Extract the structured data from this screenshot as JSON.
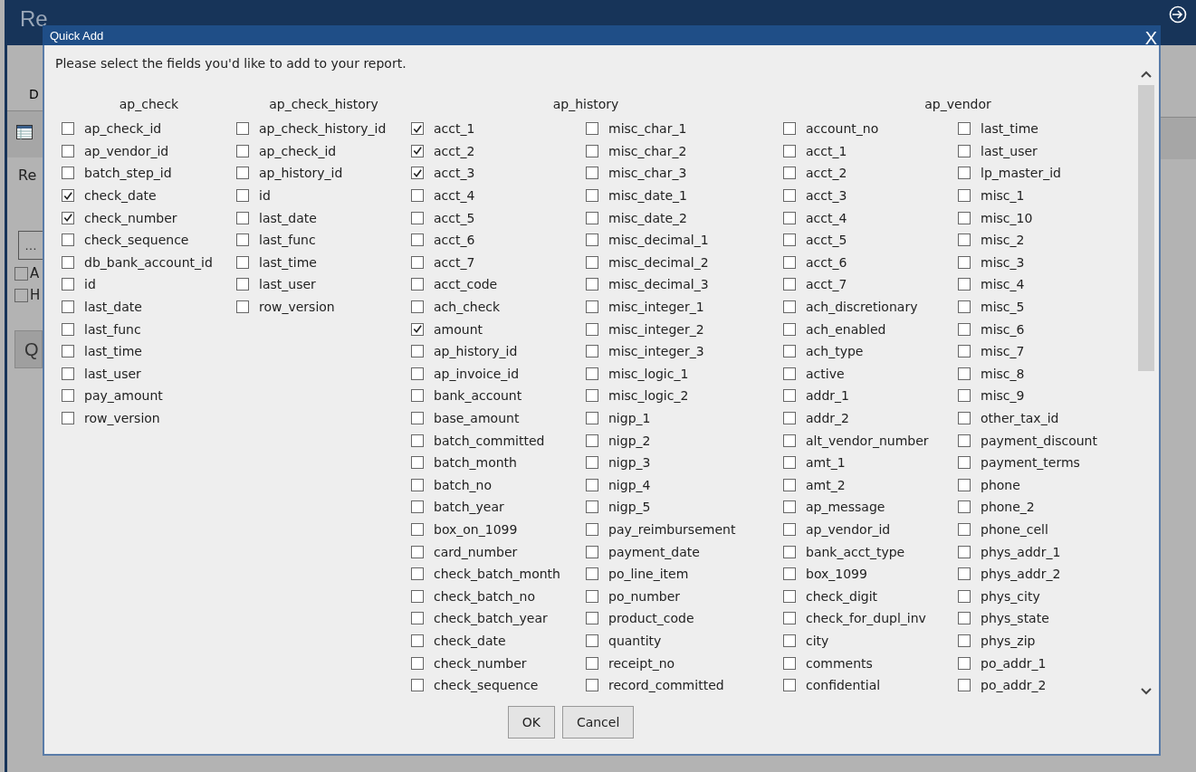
{
  "app": {
    "title": "Re",
    "tab": "D",
    "label": "Re",
    "browse_button": "…",
    "options": [
      {
        "label": "A",
        "checked": false
      },
      {
        "label": "H",
        "checked": false
      }
    ],
    "action_button": "Q"
  },
  "dialog": {
    "title": "Quick Add",
    "close": "X",
    "instruction": "Please select the fields you'd like to add to your report.",
    "groups": [
      {
        "name": "ap_check",
        "columns": [
          [
            {
              "label": "ap_check_id",
              "checked": false
            },
            {
              "label": "ap_vendor_id",
              "checked": false
            },
            {
              "label": "batch_step_id",
              "checked": false
            },
            {
              "label": "check_date",
              "checked": true
            },
            {
              "label": "check_number",
              "checked": true
            },
            {
              "label": "check_sequence",
              "checked": false
            },
            {
              "label": "db_bank_account_id",
              "checked": false
            },
            {
              "label": "id",
              "checked": false
            },
            {
              "label": "last_date",
              "checked": false
            },
            {
              "label": "last_func",
              "checked": false
            },
            {
              "label": "last_time",
              "checked": false
            },
            {
              "label": "last_user",
              "checked": false
            },
            {
              "label": "pay_amount",
              "checked": false
            },
            {
              "label": "row_version",
              "checked": false
            }
          ]
        ]
      },
      {
        "name": "ap_check_history",
        "columns": [
          [
            {
              "label": "ap_check_history_id",
              "checked": false
            },
            {
              "label": "ap_check_id",
              "checked": false
            },
            {
              "label": "ap_history_id",
              "checked": false
            },
            {
              "label": "id",
              "checked": false
            },
            {
              "label": "last_date",
              "checked": false
            },
            {
              "label": "last_func",
              "checked": false
            },
            {
              "label": "last_time",
              "checked": false
            },
            {
              "label": "last_user",
              "checked": false
            },
            {
              "label": "row_version",
              "checked": false
            }
          ]
        ]
      },
      {
        "name": "ap_history",
        "columns": [
          [
            {
              "label": "acct_1",
              "checked": true
            },
            {
              "label": "acct_2",
              "checked": true
            },
            {
              "label": "acct_3",
              "checked": true
            },
            {
              "label": "acct_4",
              "checked": false
            },
            {
              "label": "acct_5",
              "checked": false
            },
            {
              "label": "acct_6",
              "checked": false
            },
            {
              "label": "acct_7",
              "checked": false
            },
            {
              "label": "acct_code",
              "checked": false
            },
            {
              "label": "ach_check",
              "checked": false
            },
            {
              "label": "amount",
              "checked": true
            },
            {
              "label": "ap_history_id",
              "checked": false
            },
            {
              "label": "ap_invoice_id",
              "checked": false
            },
            {
              "label": "bank_account",
              "checked": false
            },
            {
              "label": "base_amount",
              "checked": false
            },
            {
              "label": "batch_committed",
              "checked": false
            },
            {
              "label": "batch_month",
              "checked": false
            },
            {
              "label": "batch_no",
              "checked": false
            },
            {
              "label": "batch_year",
              "checked": false
            },
            {
              "label": "box_on_1099",
              "checked": false
            },
            {
              "label": "card_number",
              "checked": false
            },
            {
              "label": "check_batch_month",
              "checked": false
            },
            {
              "label": "check_batch_no",
              "checked": false
            },
            {
              "label": "check_batch_year",
              "checked": false
            },
            {
              "label": "check_date",
              "checked": false
            },
            {
              "label": "check_number",
              "checked": false
            },
            {
              "label": "check_sequence",
              "checked": false
            }
          ],
          [
            {
              "label": "misc_char_1",
              "checked": false
            },
            {
              "label": "misc_char_2",
              "checked": false
            },
            {
              "label": "misc_char_3",
              "checked": false
            },
            {
              "label": "misc_date_1",
              "checked": false
            },
            {
              "label": "misc_date_2",
              "checked": false
            },
            {
              "label": "misc_decimal_1",
              "checked": false
            },
            {
              "label": "misc_decimal_2",
              "checked": false
            },
            {
              "label": "misc_decimal_3",
              "checked": false
            },
            {
              "label": "misc_integer_1",
              "checked": false
            },
            {
              "label": "misc_integer_2",
              "checked": false
            },
            {
              "label": "misc_integer_3",
              "checked": false
            },
            {
              "label": "misc_logic_1",
              "checked": false
            },
            {
              "label": "misc_logic_2",
              "checked": false
            },
            {
              "label": "nigp_1",
              "checked": false
            },
            {
              "label": "nigp_2",
              "checked": false
            },
            {
              "label": "nigp_3",
              "checked": false
            },
            {
              "label": "nigp_4",
              "checked": false
            },
            {
              "label": "nigp_5",
              "checked": false
            },
            {
              "label": "pay_reimbursement",
              "checked": false
            },
            {
              "label": "payment_date",
              "checked": false
            },
            {
              "label": "po_line_item",
              "checked": false
            },
            {
              "label": "po_number",
              "checked": false
            },
            {
              "label": "product_code",
              "checked": false
            },
            {
              "label": "quantity",
              "checked": false
            },
            {
              "label": "receipt_no",
              "checked": false
            },
            {
              "label": "record_committed",
              "checked": false
            }
          ]
        ]
      },
      {
        "name": "ap_vendor",
        "columns": [
          [
            {
              "label": "account_no",
              "checked": false
            },
            {
              "label": "acct_1",
              "checked": false
            },
            {
              "label": "acct_2",
              "checked": false
            },
            {
              "label": "acct_3",
              "checked": false
            },
            {
              "label": "acct_4",
              "checked": false
            },
            {
              "label": "acct_5",
              "checked": false
            },
            {
              "label": "acct_6",
              "checked": false
            },
            {
              "label": "acct_7",
              "checked": false
            },
            {
              "label": "ach_discretionary",
              "checked": false
            },
            {
              "label": "ach_enabled",
              "checked": false
            },
            {
              "label": "ach_type",
              "checked": false
            },
            {
              "label": "active",
              "checked": false
            },
            {
              "label": "addr_1",
              "checked": false
            },
            {
              "label": "addr_2",
              "checked": false
            },
            {
              "label": "alt_vendor_number",
              "checked": false
            },
            {
              "label": "amt_1",
              "checked": false
            },
            {
              "label": "amt_2",
              "checked": false
            },
            {
              "label": "ap_message",
              "checked": false
            },
            {
              "label": "ap_vendor_id",
              "checked": false
            },
            {
              "label": "bank_acct_type",
              "checked": false
            },
            {
              "label": "box_1099",
              "checked": false
            },
            {
              "label": "check_digit",
              "checked": false
            },
            {
              "label": "check_for_dupl_inv",
              "checked": false
            },
            {
              "label": "city",
              "checked": false
            },
            {
              "label": "comments",
              "checked": false
            },
            {
              "label": "confidential",
              "checked": false
            }
          ],
          [
            {
              "label": "last_time",
              "checked": false
            },
            {
              "label": "last_user",
              "checked": false
            },
            {
              "label": "lp_master_id",
              "checked": false
            },
            {
              "label": "misc_1",
              "checked": false
            },
            {
              "label": "misc_10",
              "checked": false
            },
            {
              "label": "misc_2",
              "checked": false
            },
            {
              "label": "misc_3",
              "checked": false
            },
            {
              "label": "misc_4",
              "checked": false
            },
            {
              "label": "misc_5",
              "checked": false
            },
            {
              "label": "misc_6",
              "checked": false
            },
            {
              "label": "misc_7",
              "checked": false
            },
            {
              "label": "misc_8",
              "checked": false
            },
            {
              "label": "misc_9",
              "checked": false
            },
            {
              "label": "other_tax_id",
              "checked": false
            },
            {
              "label": "payment_discount",
              "checked": false
            },
            {
              "label": "payment_terms",
              "checked": false
            },
            {
              "label": "phone",
              "checked": false
            },
            {
              "label": "phone_2",
              "checked": false
            },
            {
              "label": "phone_cell",
              "checked": false
            },
            {
              "label": "phys_addr_1",
              "checked": false
            },
            {
              "label": "phys_addr_2",
              "checked": false
            },
            {
              "label": "phys_city",
              "checked": false
            },
            {
              "label": "phys_state",
              "checked": false
            },
            {
              "label": "phys_zip",
              "checked": false
            },
            {
              "label": "po_addr_1",
              "checked": false
            },
            {
              "label": "po_addr_2",
              "checked": false
            }
          ]
        ]
      }
    ],
    "buttons": [
      "OK",
      "Cancel"
    ]
  }
}
